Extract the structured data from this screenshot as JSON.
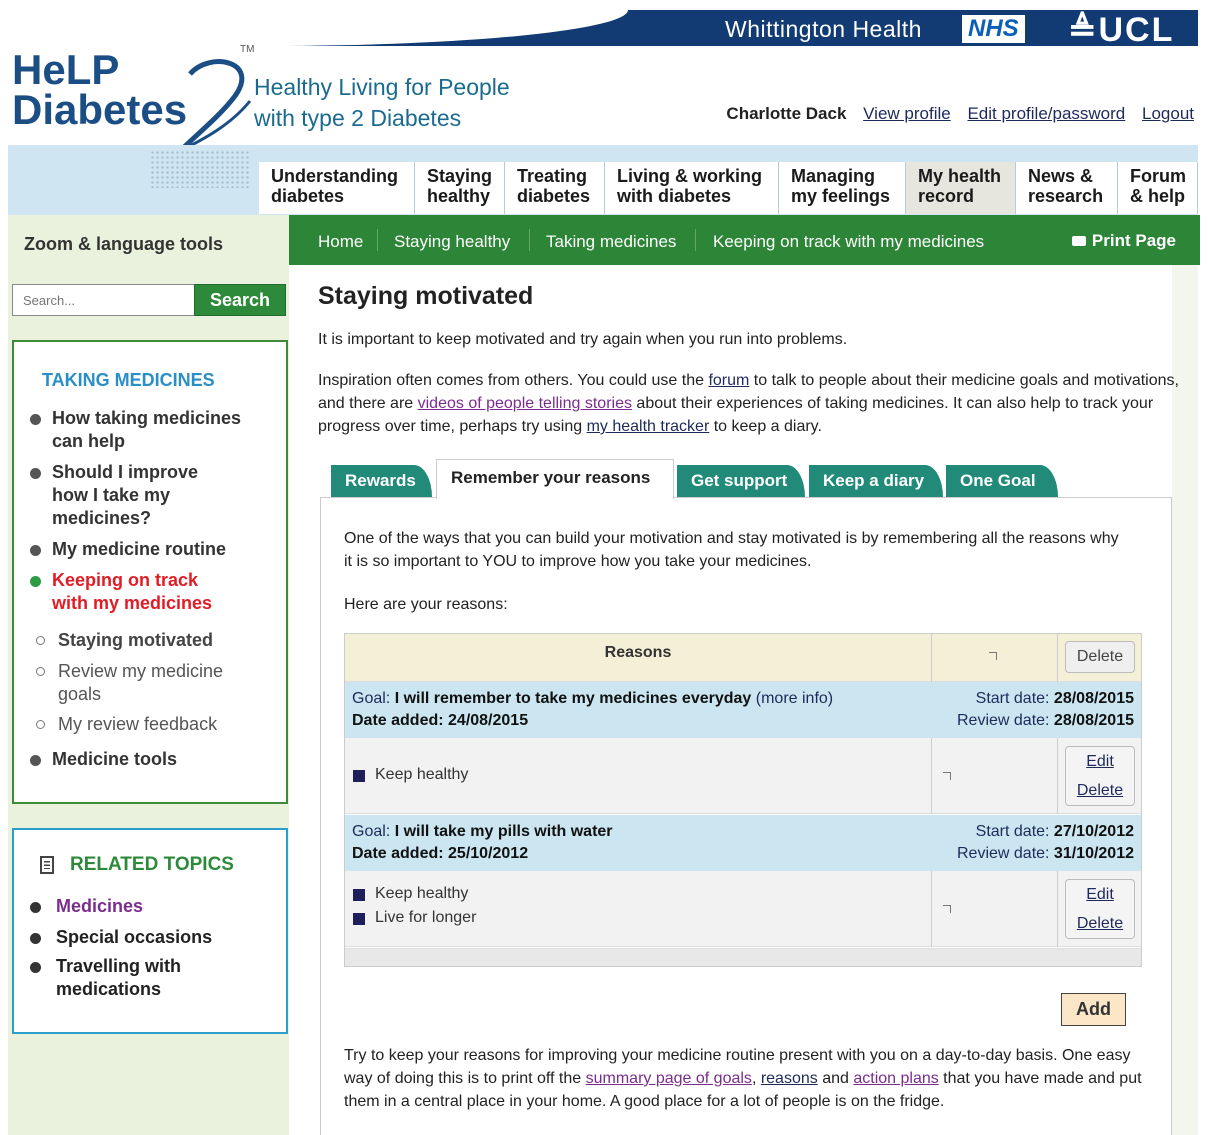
{
  "partners": {
    "whittington": "Whittington Health",
    "nhs": "NHS",
    "ucl": "UCL"
  },
  "brand": {
    "logo_line1": "HeLP",
    "logo_line2": "Diabetes",
    "logo_mark": "2",
    "tm": "TM",
    "tagline_line1": "Healthy Living for People",
    "tagline_line2": "with type 2 Diabetes"
  },
  "user": {
    "name": "Charlotte Dack",
    "view_profile": "View profile",
    "edit_profile": "Edit profile/password",
    "logout": "Logout"
  },
  "nav": [
    {
      "l1": "Understanding",
      "l2": "diabetes"
    },
    {
      "l1": "Staying",
      "l2": "healthy"
    },
    {
      "l1": "Treating",
      "l2": "diabetes"
    },
    {
      "l1": "Living & working",
      "l2": "with diabetes"
    },
    {
      "l1": "Managing",
      "l2": "my feelings"
    },
    {
      "l1": "My health",
      "l2": "record"
    },
    {
      "l1": "News &",
      "l2": "research"
    },
    {
      "l1": "Forum",
      "l2": "& help"
    }
  ],
  "sidebar": {
    "zoom_tools": "Zoom & language tools",
    "search_placeholder": "Search...",
    "search_button": "Search",
    "section_title": "TAKING MEDICINES",
    "items": [
      {
        "label": "How taking medicines can help"
      },
      {
        "label": "Should I improve how I take my medicines?"
      },
      {
        "label": "My medicine routine"
      },
      {
        "label": "Keeping on track with my medicines"
      }
    ],
    "subitems": [
      {
        "label": "Staying motivated"
      },
      {
        "label": "Review my medicine goals"
      },
      {
        "label": "My review feedback"
      }
    ],
    "medicine_tools": "Medicine tools",
    "related_title": "RELATED TOPICS",
    "related": [
      {
        "label": "Medicines"
      },
      {
        "label": "Special occasions"
      },
      {
        "label": "Travelling with medications"
      }
    ]
  },
  "breadcrumb": {
    "home": "Home",
    "c1": "Staying healthy",
    "c2": "Taking medicines",
    "c3": "Keeping on track with my medicines",
    "print": "Print Page"
  },
  "main": {
    "title": "Staying motivated",
    "p1": "It is important to keep motivated and try again when you run into problems.",
    "p2_a": "Inspiration often comes from others. You could use the ",
    "p2_forum": "forum",
    "p2_b": " to talk to people about their medicine goals and motivations, and there are ",
    "p2_videos": "videos of people telling stories",
    "p2_c": " about their experiences of taking medicines. It can also help to track your progress over time, perhaps try using ",
    "p2_tracker": "my health tracker",
    "p2_d": " to keep a diary."
  },
  "tabs": {
    "rewards": "Rewards",
    "remember": "Remember your reasons",
    "support": "Get support",
    "diary": "Keep a diary",
    "goal": "One Goal"
  },
  "panel": {
    "intro": "One of the ways that you can build your motivation and stay motivated is by remembering all the reasons why it is so important to YOU to improve how you take your medicines.",
    "here": "Here are your reasons:",
    "header_reasons": "Reasons",
    "delete": "Delete",
    "edit": "Edit",
    "goal_prefix": "Goal: ",
    "date_added_prefix": "Date added: ",
    "start_prefix": "Start date: ",
    "review_prefix": "Review date: ",
    "goals": [
      {
        "goal": "I will remember to take my medicines everyday",
        "more": " (more info)",
        "date_added": "24/08/2015",
        "start": "28/08/2015",
        "review": "28/08/2015",
        "reasons": [
          "Keep healthy"
        ]
      },
      {
        "goal": "I will take my pills with water",
        "more": "",
        "date_added": "25/10/2012",
        "start": "27/10/2012",
        "review": "31/10/2012",
        "reasons": [
          "Keep healthy",
          "Live for longer"
        ]
      }
    ],
    "add": "Add",
    "footer_a": "Try to keep your reasons for improving your medicine routine present with you on a day-to-day basis. One easy way of doing this is to print off the ",
    "footer_summary": "summary page of goals",
    "footer_b": ", ",
    "footer_reasons": "reasons",
    "footer_c": " and ",
    "footer_action": "action plans",
    "footer_d": " that you have made and put them in a central place in your home. A good place for a lot of people is on the fridge."
  }
}
